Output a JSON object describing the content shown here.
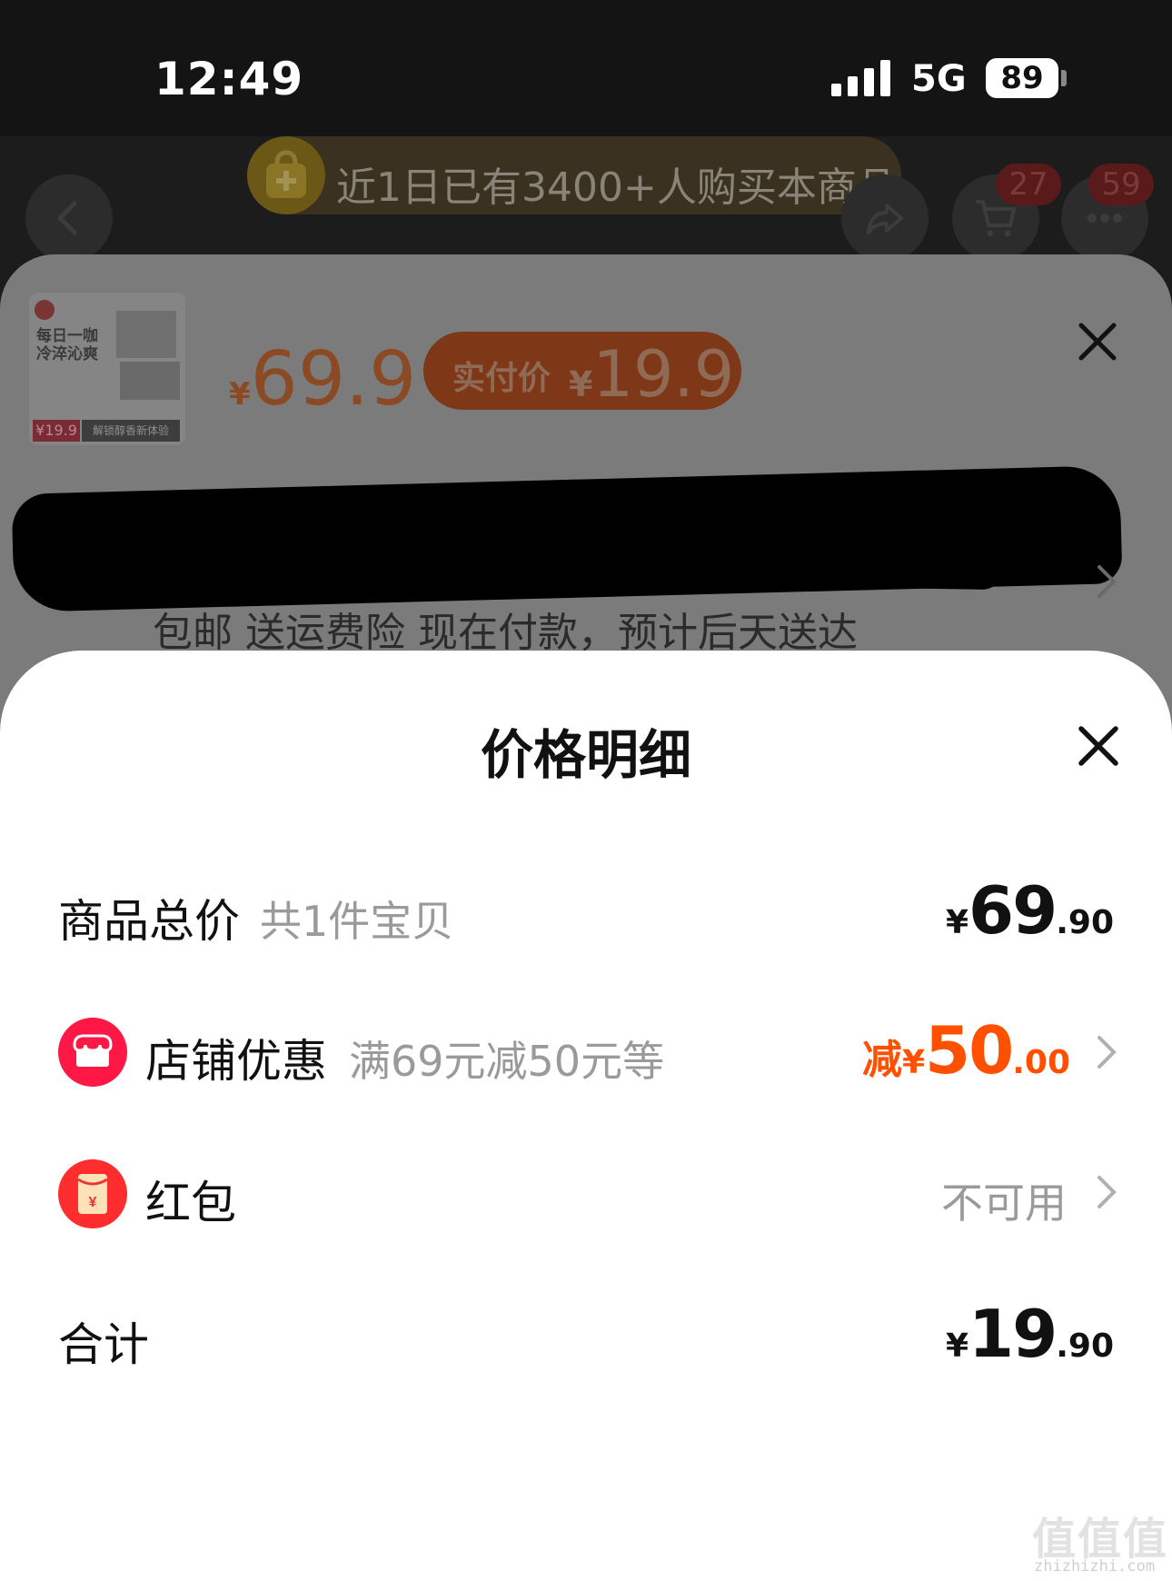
{
  "status_bar": {
    "time": "12:49",
    "network": "5G",
    "battery": "89"
  },
  "top_nav": {
    "promo_text": "近1日已有3400+人购买本商品",
    "cart_badge": "27",
    "more_badge": "59",
    "icons": [
      "back-icon",
      "share-icon",
      "cart-icon",
      "more-icon",
      "shopping-bag-icon"
    ]
  },
  "product_sheet": {
    "thumb_title": "每日一咖 冷淬沁爽",
    "thumb_price": "¥19.9",
    "thumb_tag": "解锁醇香新体验",
    "price_yen": "¥",
    "price_value": "69.9",
    "pay_label": "实付价",
    "pay_yen": "¥",
    "pay_value": "19.9",
    "shipping_text": "包邮 送运费险 现在付款，预计后天送达"
  },
  "price_detail": {
    "title": "价格明细",
    "rows": {
      "total": {
        "label": "商品总价",
        "sub": "共1件宝贝",
        "yen": "¥",
        "int": "69",
        "dec": ".90"
      },
      "shop_discount": {
        "label": "店铺优惠",
        "sub": "满69元减50元等",
        "prefix": "减",
        "yen": "¥",
        "int": "50",
        "dec": ".00"
      },
      "red_packet": {
        "label": "红包",
        "status": "不可用"
      },
      "sum": {
        "label": "合计",
        "yen": "¥",
        "int": "19",
        "dec": ".90"
      }
    }
  },
  "colors": {
    "accent": "#ff5000",
    "shop_icon": "#ff1745",
    "muted": "#9a9a9a"
  },
  "watermark": {
    "chars": "值值值",
    "url": "zhizhizhi.com"
  }
}
